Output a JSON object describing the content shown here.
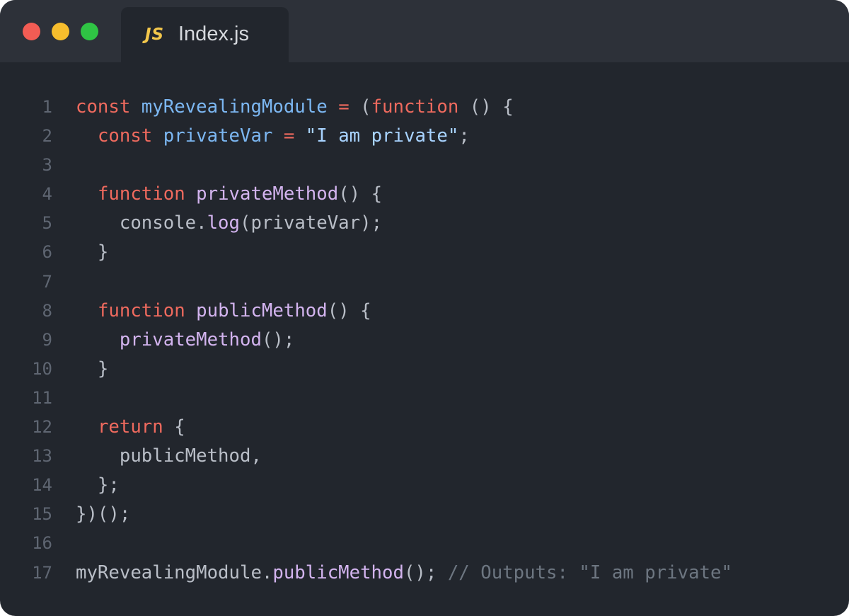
{
  "tab": {
    "icon_label": "JS",
    "title": "Index.js"
  },
  "lines": [
    {
      "number": "1",
      "tokens": [
        {
          "t": "kw",
          "v": "const"
        },
        {
          "t": "pl",
          "v": " "
        },
        {
          "t": "var",
          "v": "myRevealingModule"
        },
        {
          "t": "pl",
          "v": " "
        },
        {
          "t": "kw",
          "v": "="
        },
        {
          "t": "pl",
          "v": " ("
        },
        {
          "t": "kw",
          "v": "function"
        },
        {
          "t": "pl",
          "v": " () {"
        }
      ]
    },
    {
      "number": "2",
      "tokens": [
        {
          "t": "pl",
          "v": "  "
        },
        {
          "t": "kw",
          "v": "const"
        },
        {
          "t": "pl",
          "v": " "
        },
        {
          "t": "var",
          "v": "privateVar"
        },
        {
          "t": "pl",
          "v": " "
        },
        {
          "t": "kw",
          "v": "="
        },
        {
          "t": "pl",
          "v": " "
        },
        {
          "t": "str",
          "v": "\"I am private\""
        },
        {
          "t": "pl",
          "v": ";"
        }
      ]
    },
    {
      "number": "3",
      "tokens": []
    },
    {
      "number": "4",
      "tokens": [
        {
          "t": "pl",
          "v": "  "
        },
        {
          "t": "kw",
          "v": "function"
        },
        {
          "t": "pl",
          "v": " "
        },
        {
          "t": "fn",
          "v": "privateMethod"
        },
        {
          "t": "pl",
          "v": "() {"
        }
      ]
    },
    {
      "number": "5",
      "tokens": [
        {
          "t": "pl",
          "v": "    console."
        },
        {
          "t": "fn",
          "v": "log"
        },
        {
          "t": "pl",
          "v": "(privateVar);"
        }
      ]
    },
    {
      "number": "6",
      "tokens": [
        {
          "t": "pl",
          "v": "  }"
        }
      ]
    },
    {
      "number": "7",
      "tokens": []
    },
    {
      "number": "8",
      "tokens": [
        {
          "t": "pl",
          "v": "  "
        },
        {
          "t": "kw",
          "v": "function"
        },
        {
          "t": "pl",
          "v": " "
        },
        {
          "t": "fn",
          "v": "publicMethod"
        },
        {
          "t": "pl",
          "v": "() {"
        }
      ]
    },
    {
      "number": "9",
      "tokens": [
        {
          "t": "pl",
          "v": "    "
        },
        {
          "t": "fn",
          "v": "privateMethod"
        },
        {
          "t": "pl",
          "v": "();"
        }
      ]
    },
    {
      "number": "10",
      "tokens": [
        {
          "t": "pl",
          "v": "  }"
        }
      ]
    },
    {
      "number": "11",
      "tokens": []
    },
    {
      "number": "12",
      "tokens": [
        {
          "t": "pl",
          "v": "  "
        },
        {
          "t": "kw",
          "v": "return"
        },
        {
          "t": "pl",
          "v": " {"
        }
      ]
    },
    {
      "number": "13",
      "tokens": [
        {
          "t": "pl",
          "v": "    publicMethod,"
        }
      ]
    },
    {
      "number": "14",
      "tokens": [
        {
          "t": "pl",
          "v": "  };"
        }
      ]
    },
    {
      "number": "15",
      "tokens": [
        {
          "t": "pl",
          "v": "})();"
        }
      ]
    },
    {
      "number": "16",
      "tokens": []
    },
    {
      "number": "17",
      "tokens": [
        {
          "t": "pl",
          "v": "myRevealingModule."
        },
        {
          "t": "fn",
          "v": "publicMethod"
        },
        {
          "t": "pl",
          "v": "(); "
        },
        {
          "t": "cm",
          "v": "// Outputs: \"I am private\""
        }
      ]
    }
  ],
  "colors": {
    "window_bg": "#22262d",
    "titlebar_bg": "#2d3139",
    "keyword": "#ef6a5e",
    "variable": "#7cb7f2",
    "string": "#a8d3ff",
    "function": "#d3b4ef",
    "comment": "#6d7681",
    "plain": "#b9bec7",
    "line_number": "#5f6672",
    "js_icon": "#f3c74b"
  }
}
